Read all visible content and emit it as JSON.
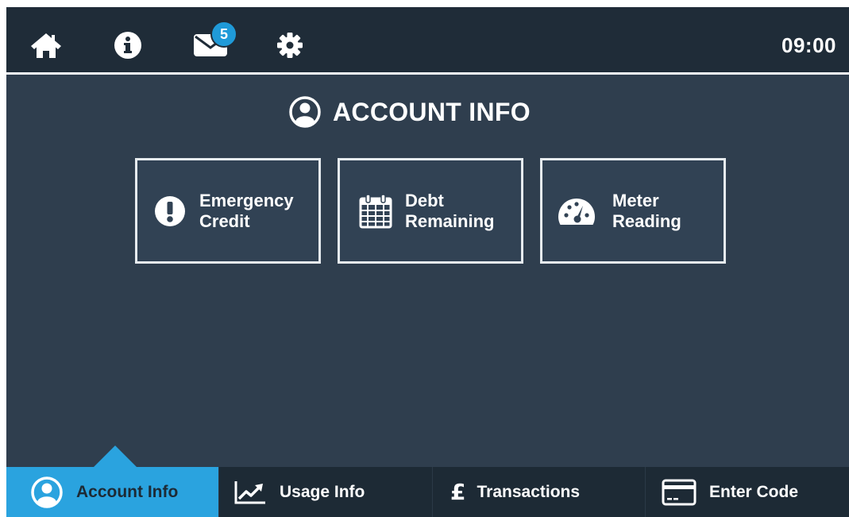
{
  "topbar": {
    "icons": [
      "home-icon",
      "info-icon",
      "mail-icon",
      "settings-icon"
    ],
    "mail_badge": "5",
    "time": "09:00"
  },
  "page": {
    "title": "ACCOUNT INFO",
    "title_icon": "user-circle-icon"
  },
  "tiles": [
    {
      "label": "Emergency\nCredit",
      "icon": "exclamation-circle-icon"
    },
    {
      "label": "Debt\nRemaining",
      "icon": "calendar-icon"
    },
    {
      "label": "Meter\nReading",
      "icon": "gauge-icon"
    }
  ],
  "bottom_nav": [
    {
      "label": "Account Info",
      "icon": "user-circle-icon",
      "active": true
    },
    {
      "label": "Usage Info",
      "icon": "line-chart-icon",
      "active": false
    },
    {
      "label": "Transactions",
      "icon": "pound-icon",
      "active": false
    },
    {
      "label": "Enter Code",
      "icon": "card-icon",
      "active": false
    }
  ],
  "colors": {
    "background": "#2f3e4e",
    "topbar": "#1f2c38",
    "accent": "#2aa3df",
    "badge": "#1f9ad8",
    "tile_border": "#e6ebef",
    "text": "#ffffff"
  }
}
